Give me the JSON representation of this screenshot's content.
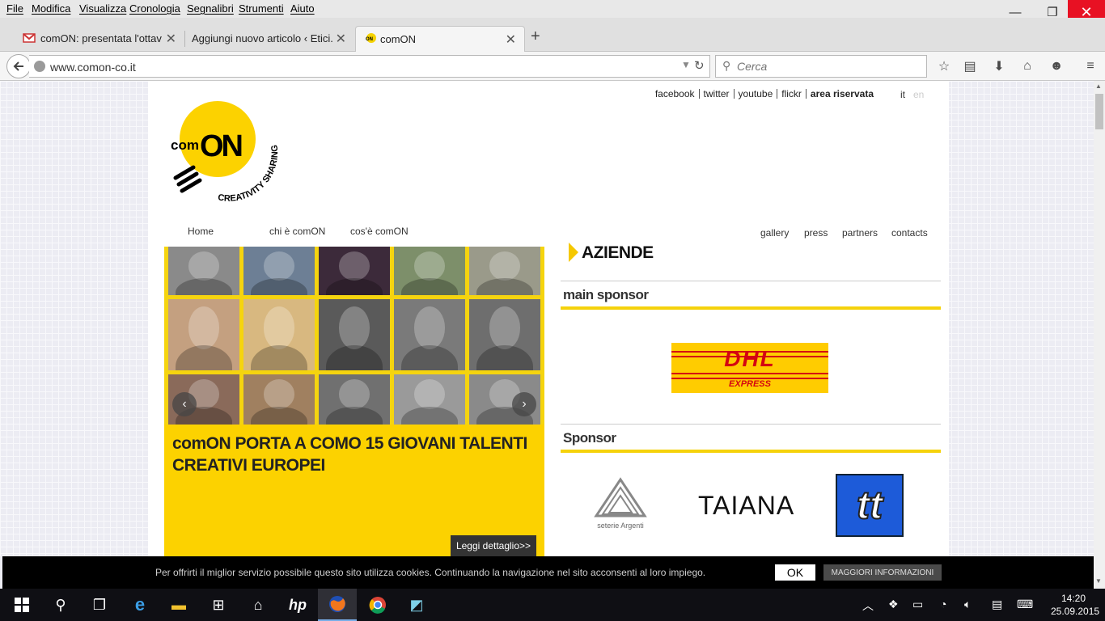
{
  "menubar": {
    "items": [
      "File",
      "Modifica",
      "Visualizza",
      "Cronologia",
      "Segnalibri",
      "Strumenti",
      "Aiuto"
    ]
  },
  "window_controls": {
    "minimize": "—",
    "restore": "❐",
    "close": "✕"
  },
  "tabs": [
    {
      "label": "comON: presentata l'ottav...",
      "icon": "gmail-icon",
      "active": false
    },
    {
      "label": "Aggiungi nuovo articolo ‹ Etici...",
      "icon": "none",
      "active": false
    },
    {
      "label": "comON",
      "icon": "comon-favicon",
      "active": true
    }
  ],
  "navbar": {
    "url": "www.comon-co.it",
    "search_placeholder": "Cerca"
  },
  "site": {
    "toplinks": [
      "facebook",
      "twitter",
      "youtube",
      "flickr",
      "area riservata"
    ],
    "lang": {
      "it": "it",
      "en": "en"
    },
    "logo": {
      "main": "ON",
      "prefix": "com",
      "tagline": "CREATIVITY SHARING"
    },
    "nav_left": [
      "Home",
      "chi è comON",
      "cos'è comON"
    ],
    "nav_right": [
      "gallery",
      "press",
      "partners",
      "contacts"
    ],
    "news": {
      "title": "comON PORTA A COMO 15 GIOVANI TALENTI CREATIVI EUROPEI",
      "more": "Leggi dettaglio>>"
    },
    "aziende": {
      "heading": "AZIENDE",
      "main_sponsor_label": "main sponsor",
      "sponsor_label": "Sponsor",
      "dhl": {
        "main": "DHL",
        "sub": "EXPRESS"
      },
      "seterie": "seterie Argenti",
      "taiana": "TAIANA",
      "tt": "tt"
    }
  },
  "cookie": {
    "text": "Per offrirti il miglior servizio possibile questo sito utilizza cookies. Continuando la navigazione nel sito acconsenti al loro impiego.",
    "ok": "OK",
    "more": "MAGGIORI INFORMAZIONI"
  },
  "taskbar": {
    "time": "14:20",
    "date": "25.09.2015"
  },
  "colors": {
    "brand_yellow": "#fcd200",
    "close_red": "#e81123"
  }
}
